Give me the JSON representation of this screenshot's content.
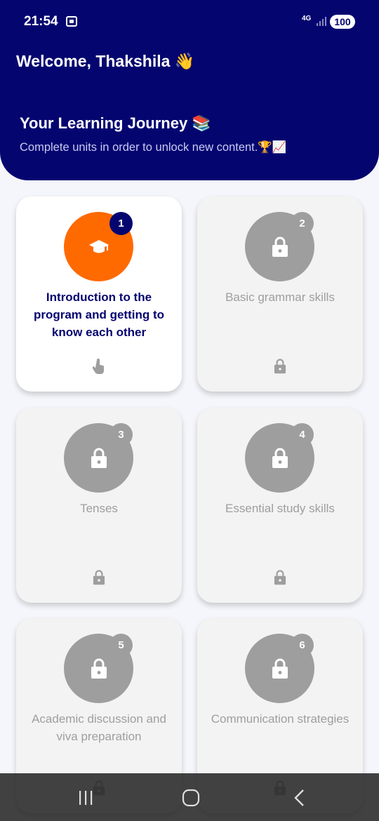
{
  "status_bar": {
    "time": "21:54",
    "network": "4G",
    "battery": "100"
  },
  "header": {
    "welcome": "Welcome, Thakshila 👋",
    "journey_title": "Your Learning Journey 📚",
    "journey_subtitle": "Complete units in order to unlock new content.🏆📈"
  },
  "units": [
    {
      "number": "1",
      "title": "Introduction to the program and getting to know each other",
      "state": "unlocked",
      "icon": "graduation-cap-icon",
      "action_icon": "tap-hand-icon"
    },
    {
      "number": "2",
      "title": "Basic grammar skills",
      "state": "locked",
      "icon": "lock-icon",
      "action_icon": "lock-icon"
    },
    {
      "number": "3",
      "title": "Tenses",
      "state": "locked",
      "icon": "lock-icon",
      "action_icon": "lock-icon"
    },
    {
      "number": "4",
      "title": "Essential study skills",
      "state": "locked",
      "icon": "lock-icon",
      "action_icon": "lock-icon"
    },
    {
      "number": "5",
      "title": "Academic discussion and viva preparation",
      "state": "locked",
      "icon": "lock-icon",
      "action_icon": "lock-icon"
    },
    {
      "number": "6",
      "title": "Communication strategies",
      "state": "locked",
      "icon": "lock-icon",
      "action_icon": "lock-icon"
    }
  ],
  "colors": {
    "header_bg": "#050570",
    "accent_orange": "#ff6a00",
    "locked_gray": "#9e9e9e"
  }
}
